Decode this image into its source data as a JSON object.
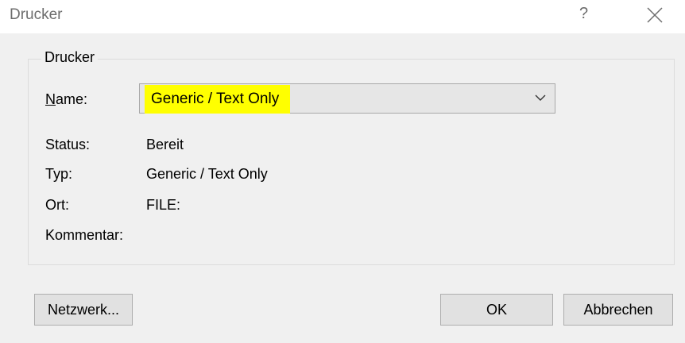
{
  "window": {
    "title": "Drucker",
    "help_label": "?",
    "close_icon": "close-icon"
  },
  "group": {
    "legend": "Drucker"
  },
  "printer": {
    "name_label_mnemonic": "N",
    "name_label_rest": "ame:",
    "selected": "Generic / Text Only",
    "highlight_color": "#ffff00",
    "status_label": "Status:",
    "status_value": "Bereit",
    "type_label": "Typ:",
    "type_value": "Generic / Text Only",
    "location_label": "Ort:",
    "location_value": "FILE:",
    "comment_label": "Kommentar:",
    "comment_value": ""
  },
  "buttons": {
    "network": "Netzwerk...",
    "ok": "OK",
    "cancel": "Abbrechen"
  }
}
